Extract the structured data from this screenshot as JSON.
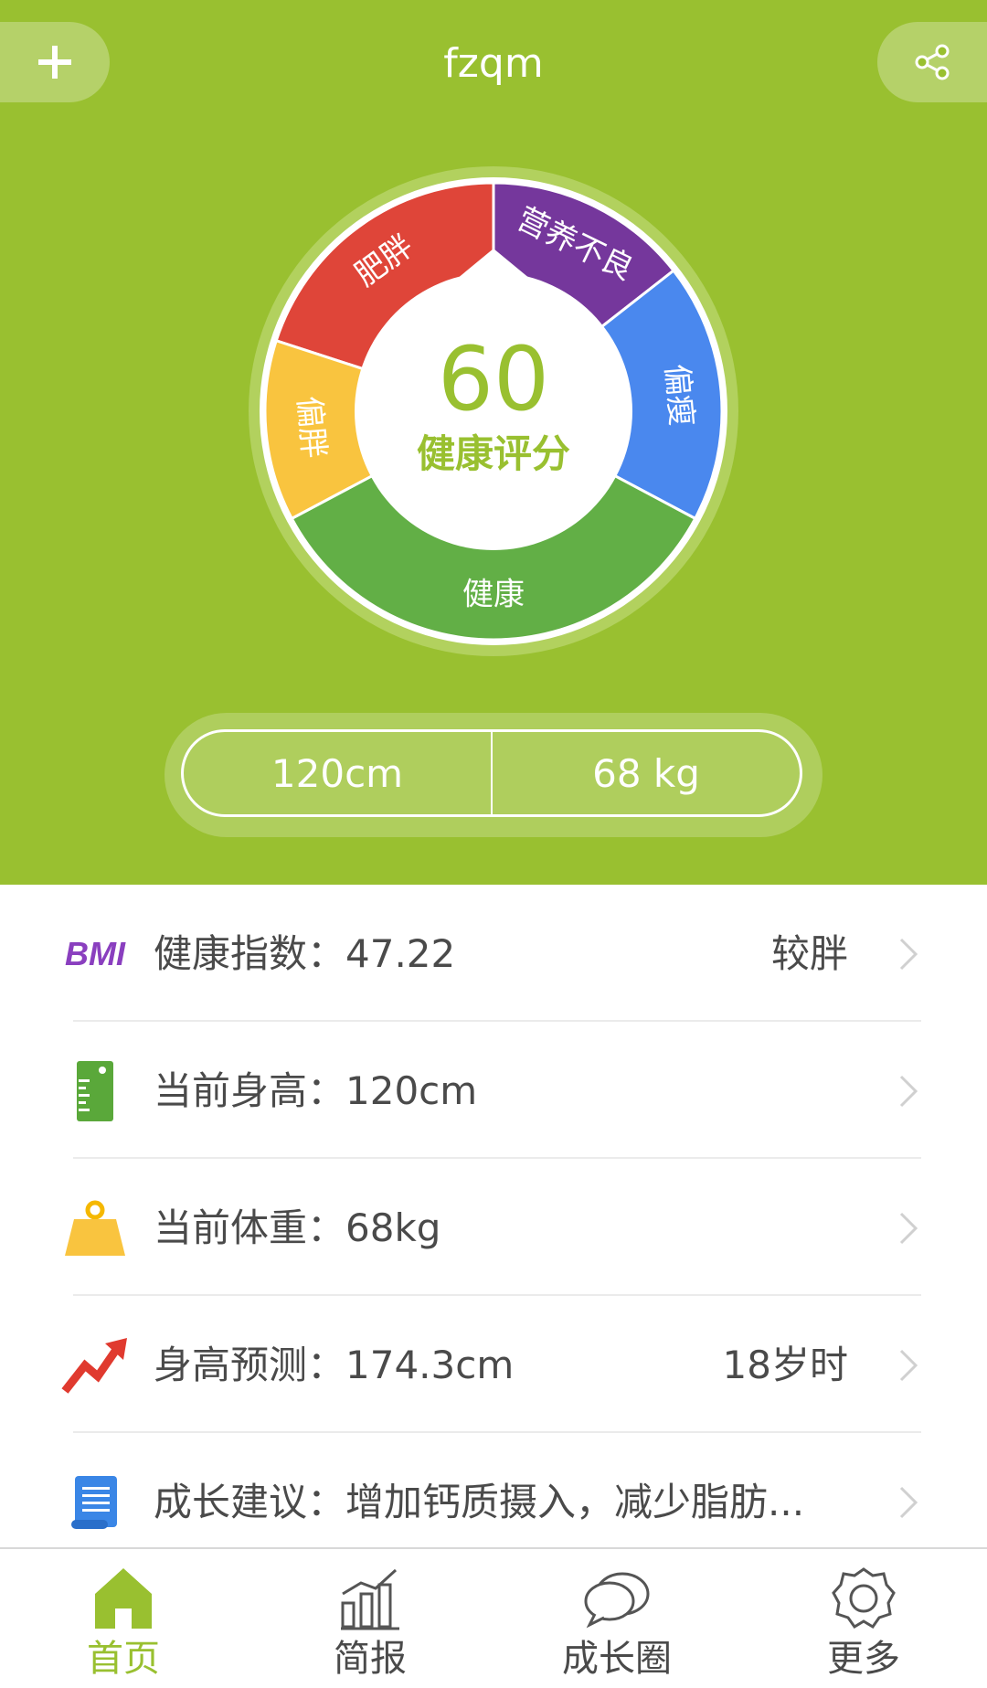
{
  "header": {
    "title": "fzqm",
    "add_icon": "plus-icon",
    "share_icon": "share-icon",
    "background_color": "#99c030"
  },
  "dial": {
    "score": "60",
    "score_label": "健康评分",
    "segments": [
      {
        "label": "肥胖",
        "color": "#df4539"
      },
      {
        "label": "营养不良",
        "color": "#75379c"
      },
      {
        "label": "偏瘦",
        "color": "#4a88ee"
      },
      {
        "label": "健康",
        "color": "#62af46"
      },
      {
        "label": "偏胖",
        "color": "#f9c43f"
      }
    ]
  },
  "measurements": {
    "height": "120cm",
    "weight": "68 kg"
  },
  "list": {
    "bmi": {
      "icon_text": "BMI",
      "label": "健康指数：",
      "value": "47.22",
      "right": "较胖"
    },
    "height": {
      "label": "当前身高：",
      "value": "120cm"
    },
    "weight": {
      "label": "当前体重：",
      "value": "68kg"
    },
    "prediction": {
      "label": "身高预测：",
      "value": "174.3cm",
      "right": "18岁时"
    },
    "advice": {
      "label": "成长建议：",
      "value": "增加钙质摄入，减少脂肪..."
    }
  },
  "tabs": [
    {
      "label": "首页",
      "icon": "home-icon",
      "active": true
    },
    {
      "label": "简报",
      "icon": "bar-chart-icon",
      "active": false
    },
    {
      "label": "成长圈",
      "icon": "chat-bubbles-icon",
      "active": false
    },
    {
      "label": "更多",
      "icon": "gear-icon",
      "active": false
    }
  ],
  "colors": {
    "accent": "#99c030",
    "text": "#4a4a4a"
  }
}
